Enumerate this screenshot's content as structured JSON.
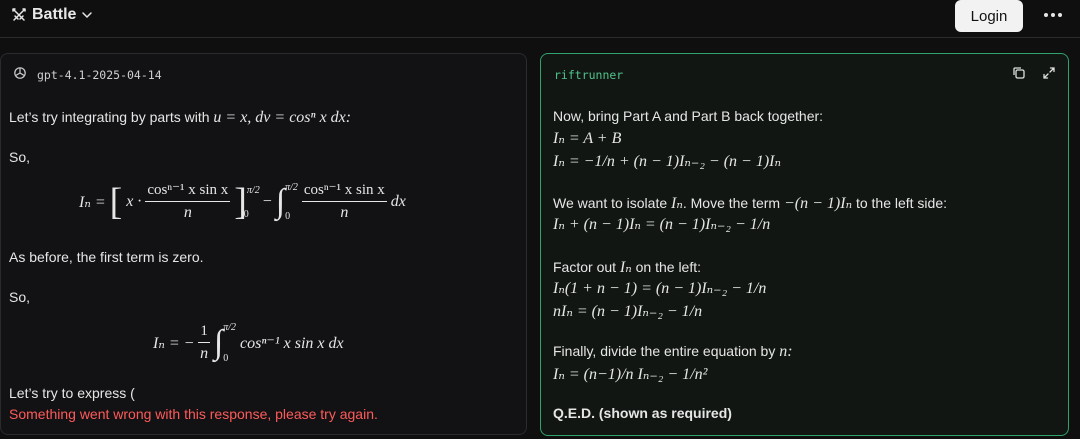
{
  "topbar": {
    "brand": "Battle",
    "login": "Login"
  },
  "left": {
    "model": "gpt-4.1-2025-04-14",
    "line1": "Let’s try integrating by parts with",
    "line1_math": "u = x, dv = cosⁿ x dx:",
    "so1": "So,",
    "eq1": {
      "lhs": "Iₙ =",
      "bracket_num": "cosⁿ⁻¹ x sin x",
      "bracket_den": "n",
      "upper": "π/2",
      "lower": "0",
      "integral_num": "cosⁿ⁻¹ x sin x",
      "integral_den": "n",
      "dx": "dx"
    },
    "before": "As before, the first term is zero.",
    "so2": "So,",
    "eq2": {
      "lhs": "Iₙ = −",
      "frac_num": "1",
      "frac_den": "n",
      "upper": "π/2",
      "lower": "0",
      "body": "cosⁿ⁻¹ x sin x dx"
    },
    "express": "Let’s try to express (",
    "error": "Something went wrong with this response, please try again."
  },
  "right": {
    "model": "riftrunner",
    "p1": "Now, bring Part A and Part B back together:",
    "eqA": "Iₙ = A + B",
    "eqB": "Iₙ = −1/n + (n − 1)Iₙ₋₂ − (n − 1)Iₙ",
    "p2_pre": "We want to isolate",
    "p2_math1": "Iₙ",
    "p2_mid": ". Move the term",
    "p2_math2": "−(n − 1)Iₙ",
    "p2_post": "to the left side:",
    "eqC": "Iₙ + (n − 1)Iₙ = (n − 1)Iₙ₋₂ − 1/n",
    "p3_pre": "Factor out",
    "p3_math": "Iₙ",
    "p3_post": "on the left:",
    "eqD": "Iₙ(1 + n − 1) = (n − 1)Iₙ₋₂ − 1/n",
    "eqE": "nIₙ = (n − 1)Iₙ₋₂ − 1/n",
    "p4_pre": "Finally, divide the entire equation by",
    "p4_math": "n:",
    "eqF": "Iₙ = (n−1)/n Iₙ₋₂ − 1/n²",
    "qed": "Q.E.D. (shown as required)"
  }
}
